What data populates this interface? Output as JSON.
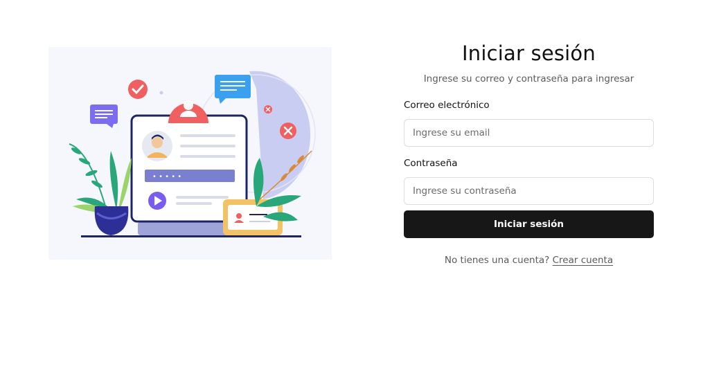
{
  "illustration": {
    "description_icon": "login-illustration",
    "colors": {
      "background": "#f6f7fc",
      "frame": "#1d2466",
      "avatar_badge": "#f06060",
      "bubble_blue": "#3aa0f0",
      "bubble_purple": "#7b6cf0",
      "password_bar": "#7a7fcf",
      "card": "#f2c265",
      "pot": "#2d2f96",
      "leaf_green": "#2aa77a",
      "leaf_light": "#9bd46a"
    },
    "password_mask": "• • • • •"
  },
  "login": {
    "title": "Iniciar sesión",
    "subtitle": "Ingrese su correo y contraseña para ingresar",
    "email_label": "Correo electrónico",
    "email_placeholder": "Ingrese su email",
    "email_value": "",
    "password_label": "Contraseña",
    "password_placeholder": "Ingrese su contraseña",
    "password_value": "",
    "submit_label": "Iniciar sesión",
    "signup_prompt": "No tienes una cuenta?",
    "signup_link": "Crear cuenta"
  },
  "theme": {
    "button_bg": "#171717",
    "button_text": "#ffffff",
    "input_border": "#dadde3"
  }
}
